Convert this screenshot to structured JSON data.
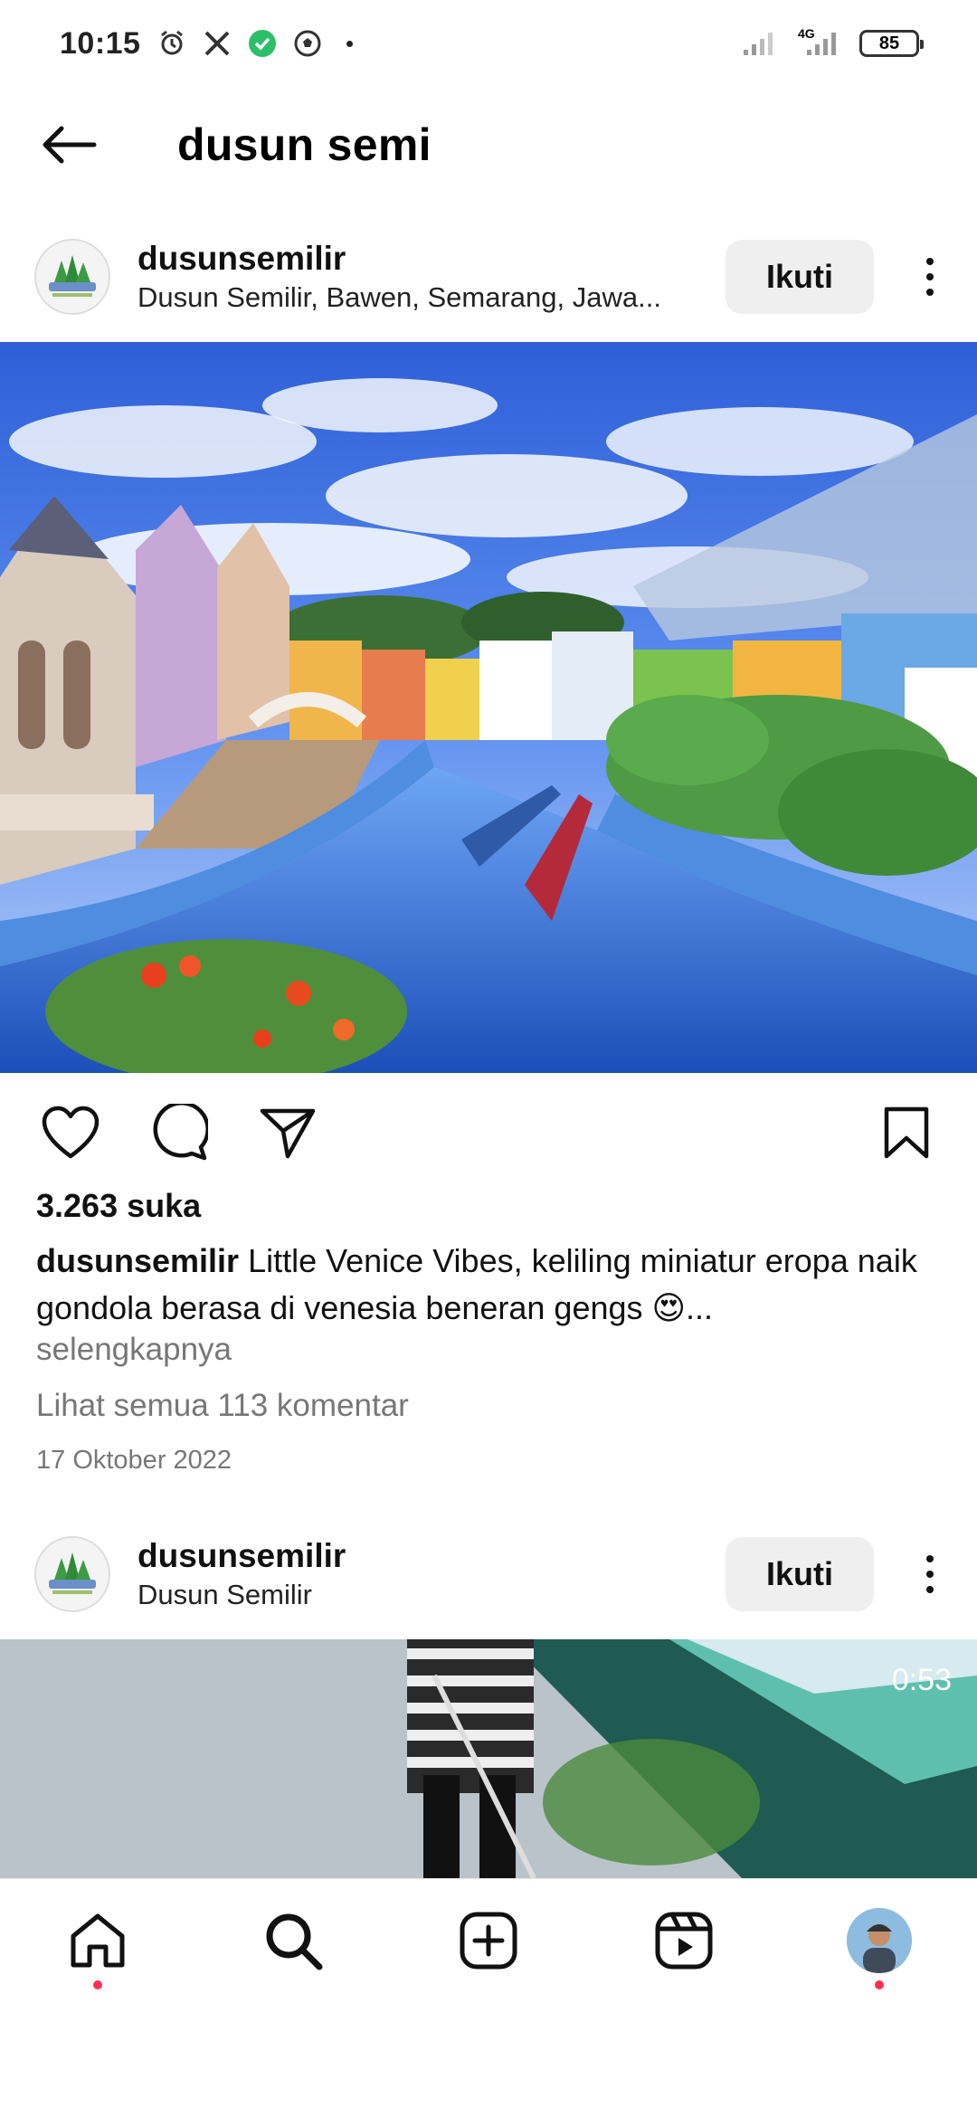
{
  "status_bar": {
    "time": "10:15",
    "network": "4G",
    "battery": "85"
  },
  "header": {
    "title": "dusun semi"
  },
  "post1": {
    "username": "dusunsemilir",
    "location": "Dusun Semilir, Bawen, Semarang, Jawa...",
    "follow_label": "Ikuti",
    "likes": "3.263 suka",
    "caption_user": "dusunsemilir",
    "caption_text": " Little Venice Vibes, keliling miniatur eropa naik gondola berasa di venesia beneran gengs 😍...",
    "more_label": "selengkapnya",
    "comments_label": "Lihat semua 113 komentar",
    "date": "17 Oktober 2022"
  },
  "post2": {
    "username": "dusunsemilir",
    "location": "Dusun Semilir",
    "follow_label": "Ikuti",
    "video_duration": "0:53"
  },
  "icons": {
    "back": "arrow-left-icon",
    "like": "heart-icon",
    "comment": "comment-icon",
    "share": "send-icon",
    "save": "bookmark-icon",
    "home": "home-icon",
    "search": "search-icon",
    "create": "plus-square-icon",
    "reels": "reels-icon"
  },
  "colors": {
    "follow_bg": "#efefef",
    "notification_dot": "#ff2d55",
    "muted_text": "#777777"
  }
}
